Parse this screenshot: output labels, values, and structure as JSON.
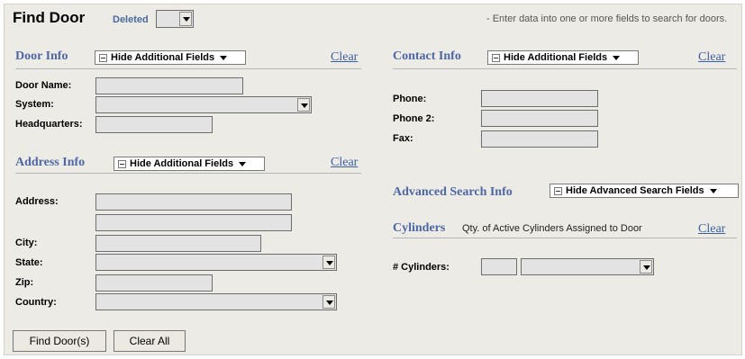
{
  "header": {
    "title": "Find Door",
    "deleted_label": "Deleted",
    "deleted_value": "",
    "hint": "- Enter data into one or more fields to search for doors."
  },
  "door_info": {
    "title": "Door Info",
    "toggle_label": "Hide Additional Fields",
    "clear": "Clear",
    "door_name_label": "Door Name:",
    "system_label": "System:",
    "headquarters_label": "Headquarters:"
  },
  "address_info": {
    "title": "Address Info",
    "toggle_label": "Hide Additional Fields",
    "clear": "Clear",
    "address_label": "Address:",
    "city_label": "City:",
    "state_label": "State:",
    "zip_label": "Zip:",
    "country_label": "Country:"
  },
  "contact_info": {
    "title": "Contact Info",
    "toggle_label": "Hide Additional Fields",
    "clear": "Clear",
    "phone_label": "Phone:",
    "phone2_label": "Phone 2:",
    "fax_label": "Fax:"
  },
  "advanced": {
    "title": "Advanced Search Info",
    "toggle_label": "Hide Advanced Search Fields"
  },
  "cylinders": {
    "title": "Cylinders",
    "subtitle": "Qty. of Active Cylinders Assigned to Door",
    "clear": "Clear",
    "count_label": "# Cylinders:"
  },
  "buttons": {
    "find": "Find Door(s)",
    "clear_all": "Clear All"
  }
}
